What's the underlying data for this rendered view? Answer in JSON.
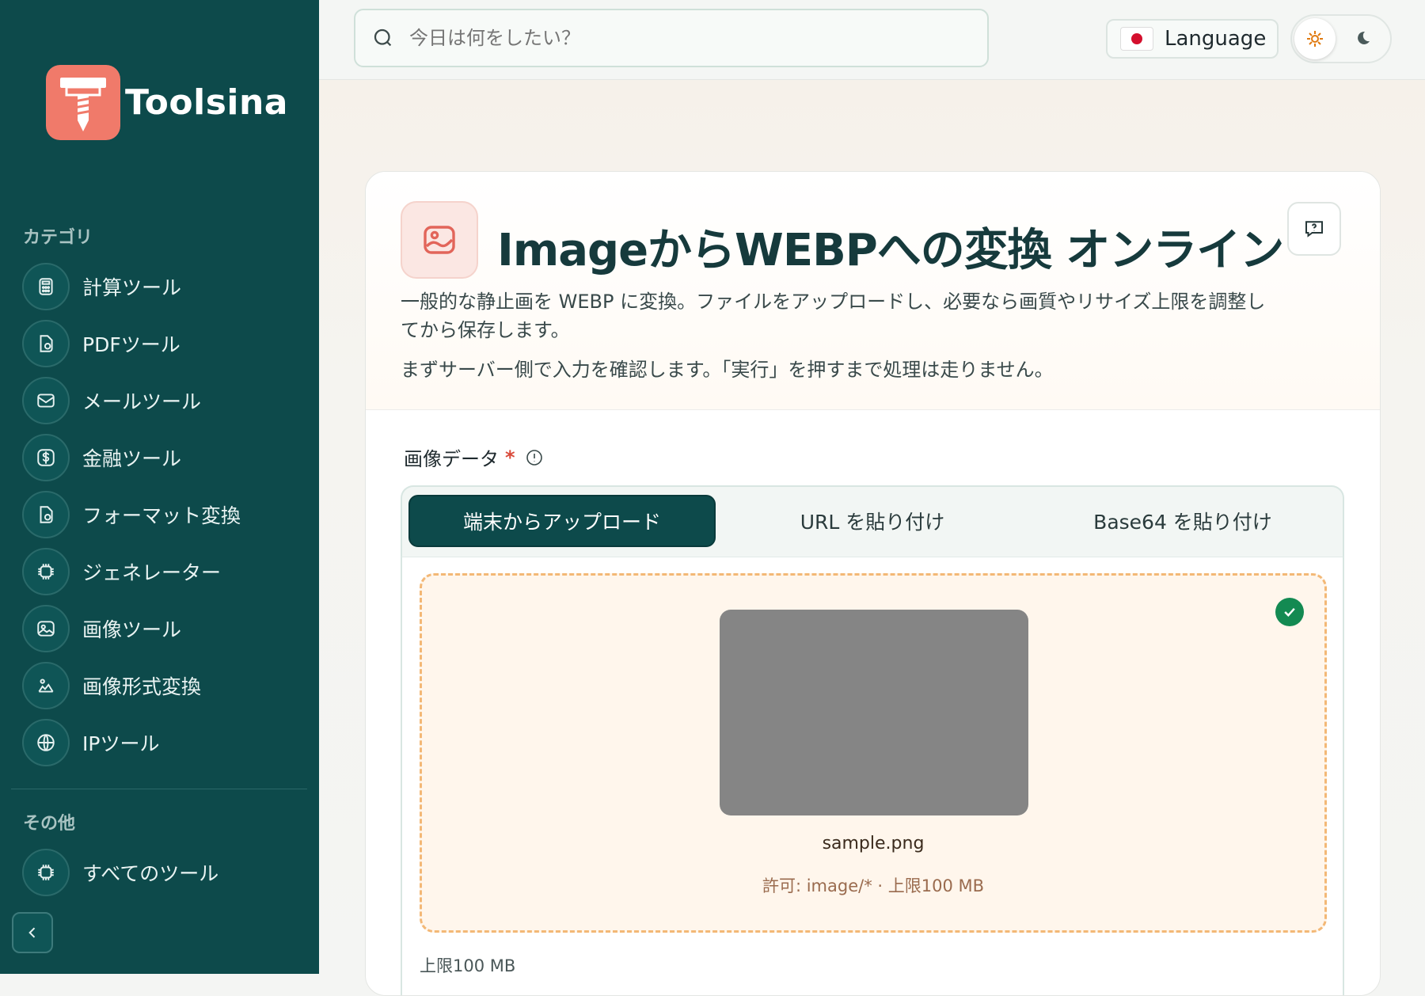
{
  "brand": {
    "name": "Toolsina"
  },
  "sidebar": {
    "categories_label": "カテゴリ",
    "items": [
      {
        "label": "計算ツール",
        "icon": "calculator-icon"
      },
      {
        "label": "PDFツール",
        "icon": "file-icon"
      },
      {
        "label": "メールツール",
        "icon": "mail-icon"
      },
      {
        "label": "金融ツール",
        "icon": "dollar-icon"
      },
      {
        "label": "フォーマット変換",
        "icon": "file-icon"
      },
      {
        "label": "ジェネレーター",
        "icon": "chip-icon"
      },
      {
        "label": "画像ツール",
        "icon": "image-icon"
      },
      {
        "label": "画像形式変換",
        "icon": "image-convert-icon"
      },
      {
        "label": "IPツール",
        "icon": "globe-icon"
      }
    ],
    "other_label": "その他",
    "other_items": [
      {
        "label": "すべてのツール",
        "icon": "chip-icon"
      }
    ]
  },
  "topbar": {
    "search_placeholder": "今日は何をしたい？",
    "language_label": "Language"
  },
  "tool": {
    "title": "ImageからWEBPへの変換 オンライン",
    "description": "一般的な静止画を WEBP に変換。ファイルをアップロードし、必要なら画質やリサイズ上限を調整してから保存します。",
    "note": "まずサーバー側で入力を確認します。「実行」を押すまで処理は走りません。",
    "field_label": "画像データ",
    "required_mark": "*",
    "tabs": [
      {
        "label": "端末からアップロード",
        "active": true
      },
      {
        "label": "URL を貼り付け",
        "active": false
      },
      {
        "label": "Base64 を貼り付け",
        "active": false
      }
    ],
    "file_name": "sample.png",
    "allowed_text": "許可: image/* · 上限100 MB",
    "limit_text": "上限100 MB"
  },
  "colors": {
    "sidebar_bg": "#0d4a4b",
    "brand_accent": "#f07a6a",
    "dropzone_border": "#f3b876",
    "success": "#138a52"
  }
}
